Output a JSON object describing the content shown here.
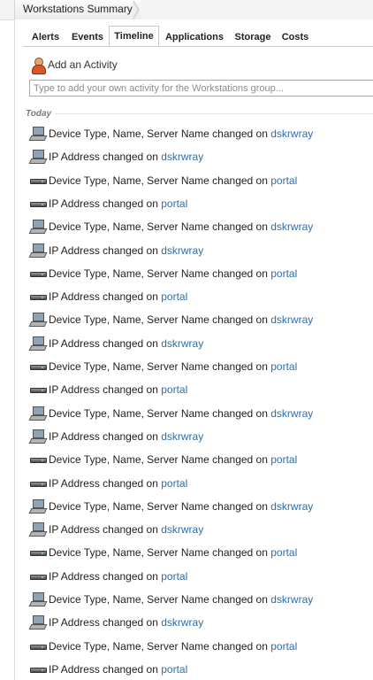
{
  "breadcrumb": {
    "title": "Workstations Summary"
  },
  "tabs": [
    {
      "label": "Alerts"
    },
    {
      "label": "Events"
    },
    {
      "label": "Timeline",
      "active": true
    },
    {
      "label": "Applications"
    },
    {
      "label": "Storage"
    },
    {
      "label": "Costs"
    }
  ],
  "activity": {
    "add_label": "Add an Activity",
    "placeholder": "Type to add your own activity for the Workstations group..."
  },
  "timeline": {
    "day_label": "Today",
    "entries": [
      {
        "icon": "workstation-icon",
        "text": "Device Type, Name, Server Name changed on ",
        "link": "dskrwray"
      },
      {
        "icon": "workstation-icon",
        "text": "IP Address changed on ",
        "link": "dskrwray"
      },
      {
        "icon": "server-icon",
        "text": "Device Type, Name, Server Name changed on ",
        "link": "portal"
      },
      {
        "icon": "server-icon",
        "text": "IP Address changed on ",
        "link": "portal"
      },
      {
        "icon": "workstation-icon",
        "text": "Device Type, Name, Server Name changed on ",
        "link": "dskrwray"
      },
      {
        "icon": "workstation-icon",
        "text": "IP Address changed on ",
        "link": "dskrwray"
      },
      {
        "icon": "server-icon",
        "text": "Device Type, Name, Server Name changed on ",
        "link": "portal"
      },
      {
        "icon": "server-icon",
        "text": "IP Address changed on ",
        "link": "portal"
      },
      {
        "icon": "workstation-icon",
        "text": "Device Type, Name, Server Name changed on ",
        "link": "dskrwray"
      },
      {
        "icon": "workstation-icon",
        "text": "IP Address changed on ",
        "link": "dskrwray"
      },
      {
        "icon": "server-icon",
        "text": "Device Type, Name, Server Name changed on ",
        "link": "portal"
      },
      {
        "icon": "server-icon",
        "text": "IP Address changed on ",
        "link": "portal"
      },
      {
        "icon": "workstation-icon",
        "text": "Device Type, Name, Server Name changed on ",
        "link": "dskrwray"
      },
      {
        "icon": "workstation-icon",
        "text": "IP Address changed on ",
        "link": "dskrwray"
      },
      {
        "icon": "server-icon",
        "text": "Device Type, Name, Server Name changed on ",
        "link": "portal"
      },
      {
        "icon": "server-icon",
        "text": "IP Address changed on ",
        "link": "portal"
      },
      {
        "icon": "workstation-icon",
        "text": "Device Type, Name, Server Name changed on ",
        "link": "dskrwray"
      },
      {
        "icon": "workstation-icon",
        "text": "IP Address changed on ",
        "link": "dskrwray"
      },
      {
        "icon": "server-icon",
        "text": "Device Type, Name, Server Name changed on ",
        "link": "portal"
      },
      {
        "icon": "server-icon",
        "text": "IP Address changed on ",
        "link": "portal"
      },
      {
        "icon": "workstation-icon",
        "text": "Device Type, Name, Server Name changed on ",
        "link": "dskrwray"
      },
      {
        "icon": "workstation-icon",
        "text": "IP Address changed on ",
        "link": "dskrwray"
      },
      {
        "icon": "server-icon",
        "text": "Device Type, Name, Server Name changed on ",
        "link": "portal"
      },
      {
        "icon": "server-icon",
        "text": "IP Address changed on ",
        "link": "portal"
      }
    ]
  },
  "colors": {
    "link": "#2f6ea5",
    "accent": "#d8562a"
  }
}
